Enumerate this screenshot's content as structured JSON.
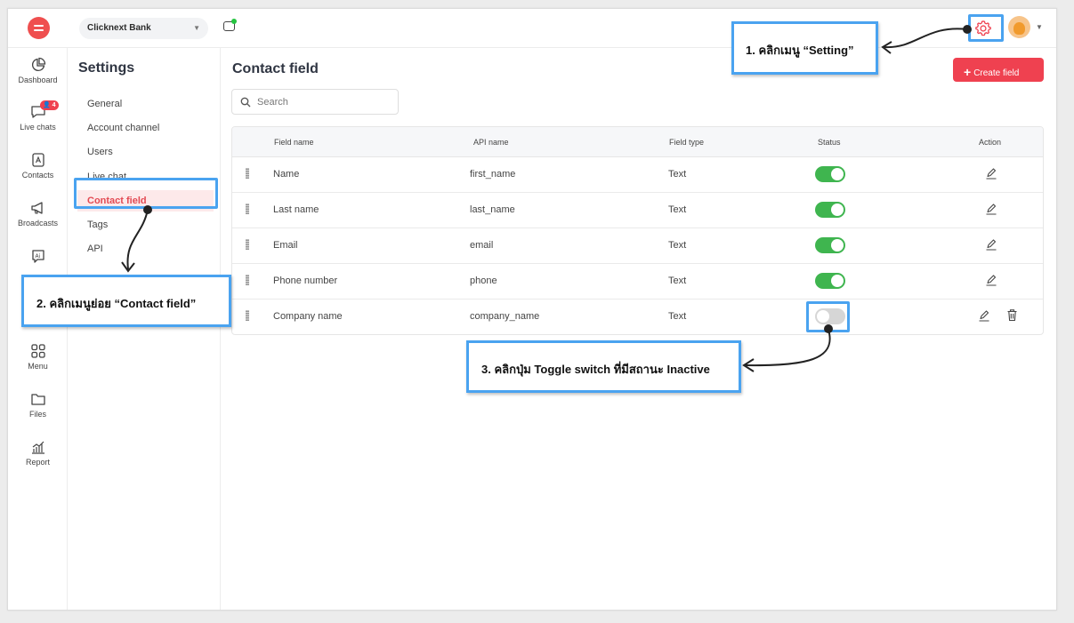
{
  "workspace": {
    "name": "Clicknext Bank"
  },
  "rail": {
    "items": [
      {
        "label": "Dashboard"
      },
      {
        "label": "Live chats",
        "badge": "4"
      },
      {
        "label": "Contacts"
      },
      {
        "label": "Broadcasts"
      },
      {
        "label": "Menu"
      },
      {
        "label": "Files"
      },
      {
        "label": "Report"
      }
    ]
  },
  "settings": {
    "title": "Settings",
    "items": [
      {
        "label": "General"
      },
      {
        "label": "Account channel"
      },
      {
        "label": "Users"
      },
      {
        "label": "Live chat"
      },
      {
        "label": "Contact field",
        "active": true
      },
      {
        "label": "Tags"
      },
      {
        "label": "API"
      }
    ]
  },
  "main": {
    "title": "Contact field",
    "create_label": "Create field",
    "search_placeholder": "Search",
    "columns": [
      "Field name",
      "API name",
      "Field type",
      "Status",
      "Action"
    ],
    "rows": [
      {
        "name": "Name",
        "api": "first_name",
        "type": "Text",
        "status": "on"
      },
      {
        "name": "Last name",
        "api": "last_name",
        "type": "Text",
        "status": "on"
      },
      {
        "name": "Email",
        "api": "email",
        "type": "Text",
        "status": "on"
      },
      {
        "name": "Phone number",
        "api": "phone",
        "type": "Text",
        "status": "on"
      },
      {
        "name": "Company name",
        "api": "company_name",
        "type": "Text",
        "status": "off"
      }
    ]
  },
  "annotations": {
    "step1": "1. คลิกเมนู “Setting”",
    "step2": "2. คลิกเมนูย่อย “Contact field”",
    "step3": "3. คลิกปุ่ม Toggle switch ที่มีสถานะ Inactive"
  },
  "colors": {
    "accent": "#ef4150",
    "toggle_on": "#3fb54f",
    "callout_border": "#4aa3f0"
  }
}
